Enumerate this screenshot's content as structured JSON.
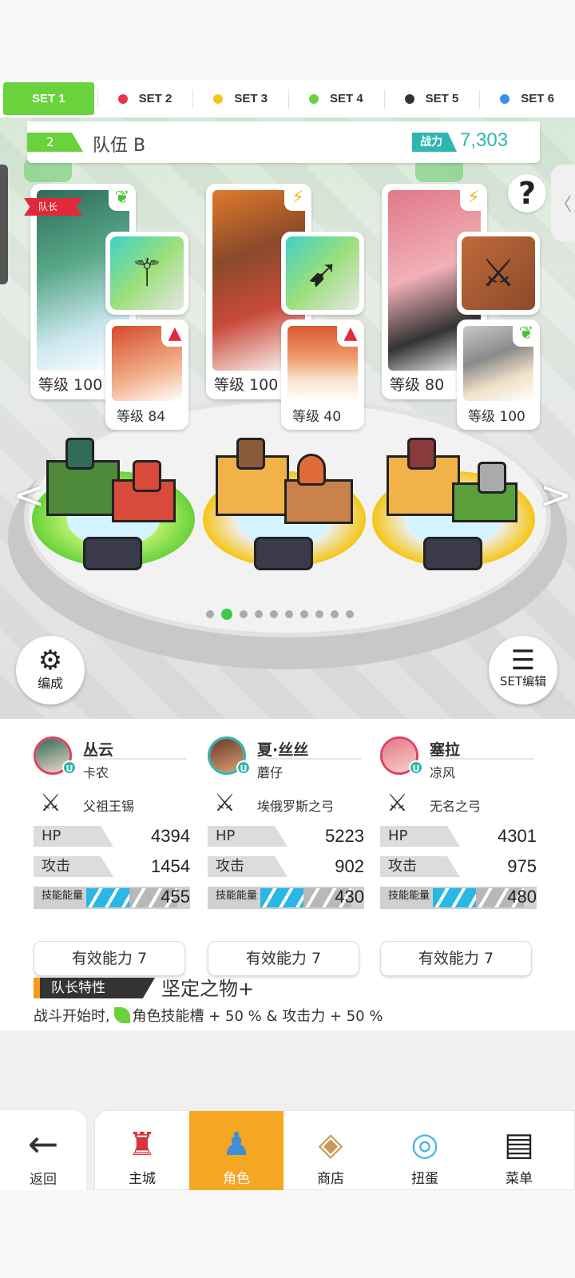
{
  "set_tabs": [
    {
      "label": "SET 1",
      "color": "#6ad23c",
      "active": true
    },
    {
      "label": "SET 2",
      "color": "#e8344c"
    },
    {
      "label": "SET 3",
      "color": "#f5c61a"
    },
    {
      "label": "SET 4",
      "color": "#6ad23c"
    },
    {
      "label": "SET 5",
      "color": "#333333"
    },
    {
      "label": "SET 6",
      "color": "#3c8fe8"
    }
  ],
  "team": {
    "number": "2",
    "name": "队伍 B",
    "power_label": "战力",
    "power_value": "7,303"
  },
  "leader_tag": "队长",
  "characters": [
    {
      "level": "等级 100",
      "element_icon": "leaf-icon",
      "weapon_icon": "staff-icon",
      "partner_level": "等级 84",
      "partner_element_icon": "triforce-icon"
    },
    {
      "level": "等级 100",
      "element_icon": "lightning-icon",
      "weapon_icon": "bow-icon",
      "partner_level": "等级 40",
      "partner_element_icon": "triforce-icon"
    },
    {
      "level": "等级 80",
      "element_icon": "lightning-icon",
      "weapon_icon": "crossbow-icon",
      "partner_level": "等级 100",
      "partner_element_icon": "leaf-icon"
    }
  ],
  "help_label": "?",
  "side_tab_label": "〈",
  "arrows": {
    "left": "<",
    "right": ">"
  },
  "pager": {
    "count": 10,
    "active": 1
  },
  "buttons": {
    "formation": "编成",
    "set_edit": "SET编辑"
  },
  "stats": [
    {
      "name": "丛云",
      "partner": "卡农",
      "weapon": "父祖王锡",
      "hp_label": "HP",
      "hp": "4394",
      "atk_label": "攻击",
      "atk": "1454",
      "energy_label": "技能能量",
      "energy": "455",
      "ability": "有效能力 7",
      "badge": "U"
    },
    {
      "name": "夏·丝丝",
      "partner": "蘑仔",
      "weapon": "埃俄罗斯之弓",
      "hp_label": "HP",
      "hp": "5223",
      "atk_label": "攻击",
      "atk": "902",
      "energy_label": "技能能量",
      "energy": "430",
      "ability": "有效能力 7",
      "badge": "U"
    },
    {
      "name": "塞拉",
      "partner": "凉风",
      "weapon": "无名之弓",
      "hp_label": "HP",
      "hp": "4301",
      "atk_label": "攻击",
      "atk": "975",
      "energy_label": "技能能量",
      "energy": "480",
      "ability": "有效能力 7",
      "badge": "U"
    }
  ],
  "leader_trait": {
    "label": "队长特性",
    "name": "坚定之物+",
    "desc_prefix": "战斗开始时,",
    "desc_suffix": "角色技能槽 + 50 % & 攻击力 + 50 %"
  },
  "nav": {
    "back": "返回",
    "items": [
      {
        "label": "主城",
        "icon": "castle-icon"
      },
      {
        "label": "角色",
        "icon": "character-icon",
        "active": true
      },
      {
        "label": "商店",
        "icon": "shop-icon"
      },
      {
        "label": "扭蛋",
        "icon": "gacha-icon"
      },
      {
        "label": "菜单",
        "icon": "menu-icon"
      }
    ]
  }
}
